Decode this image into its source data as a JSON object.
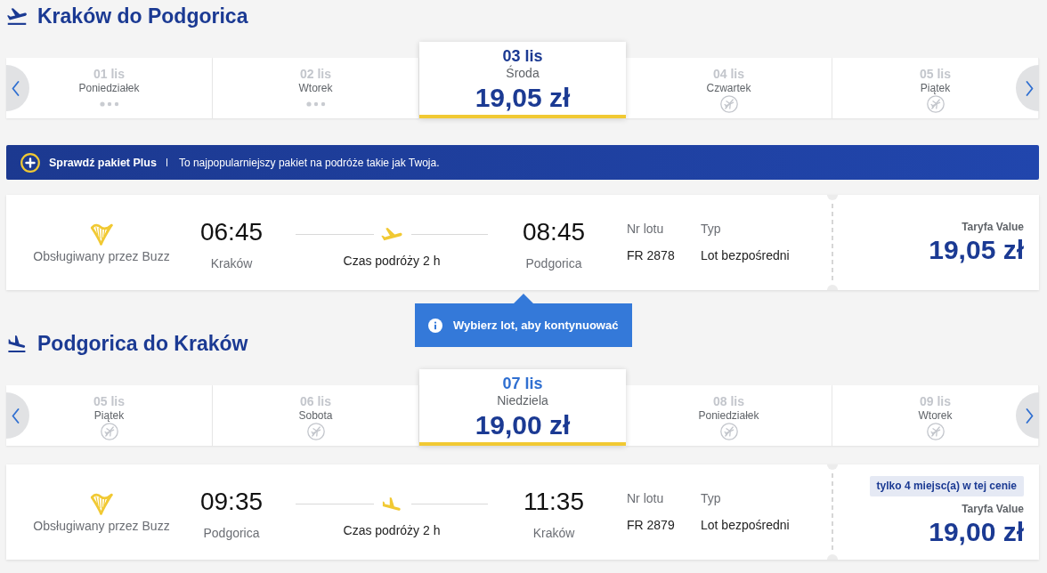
{
  "sections": [
    {
      "kind": "outbound",
      "title": "Kraków do Podgorica",
      "days": [
        {
          "date": "01 lis",
          "weekday": "Poniedziałek",
          "kind": "pending",
          "selected": false,
          "color": "#c3c6cc"
        },
        {
          "date": "02 lis",
          "weekday": "Wtorek",
          "kind": "pending",
          "selected": false,
          "color": "#c3c6cc"
        },
        {
          "date": "03 lis",
          "weekday": "Środa",
          "kind": "fare",
          "price": "19,05 zł",
          "selected": true,
          "color": "#1b3a93"
        },
        {
          "date": "04 lis",
          "weekday": "Czwartek",
          "kind": "none",
          "selected": false,
          "color": "#c3c6cc"
        },
        {
          "date": "05 lis",
          "weekday": "Piątek",
          "kind": "none",
          "selected": false,
          "color": "#c3c6cc"
        }
      ],
      "promo": {
        "title": "Sprawdź pakiet Plus",
        "text": "To najpopularniejszy pakiet na podróże takie jak Twoja."
      },
      "flight": {
        "operator": "Obsługiwany przez Buzz",
        "departure": {
          "time": "06:45",
          "city": "Kraków"
        },
        "duration": "Czas podróży 2 h",
        "arrival": {
          "time": "08:45",
          "city": "Podgorica"
        },
        "number_label": "Nr lotu",
        "number": "FR 2878",
        "type_label": "Typ",
        "type": "Lot bezpośredni",
        "fare": "Taryfa Value",
        "price": "19,05 zł"
      },
      "tooltip": "Wybierz lot, aby kontynuować"
    },
    {
      "kind": "return",
      "title": "Podgorica do Kraków",
      "days": [
        {
          "date": "05 lis",
          "weekday": "Piątek",
          "kind": "none",
          "selected": false,
          "color": "#c3c6cc"
        },
        {
          "date": "06 lis",
          "weekday": "Sobota",
          "kind": "none",
          "selected": false,
          "color": "#c3c6cc"
        },
        {
          "date": "07 lis",
          "weekday": "Niedziela",
          "kind": "fare",
          "price": "19,00 zł",
          "selected": true,
          "color": "#2f6fd1"
        },
        {
          "date": "08 lis",
          "weekday": "Poniedziałek",
          "kind": "none",
          "selected": false,
          "color": "#c3c6cc"
        },
        {
          "date": "09 lis",
          "weekday": "Wtorek",
          "kind": "none",
          "selected": false,
          "color": "#c3c6cc"
        }
      ],
      "flight": {
        "operator": "Obsługiwany przez Buzz",
        "departure": {
          "time": "09:35",
          "city": "Podgorica"
        },
        "duration": "Czas podróży 2 h",
        "arrival": {
          "time": "11:35",
          "city": "Kraków"
        },
        "number_label": "Nr lotu",
        "number": "FR 2879",
        "type_label": "Typ",
        "type": "Lot bezpośredni",
        "badge": "tylko 4 miejsc(a) w tej cenie",
        "fare": "Taryfa Value",
        "price": "19,00 zł"
      }
    }
  ]
}
